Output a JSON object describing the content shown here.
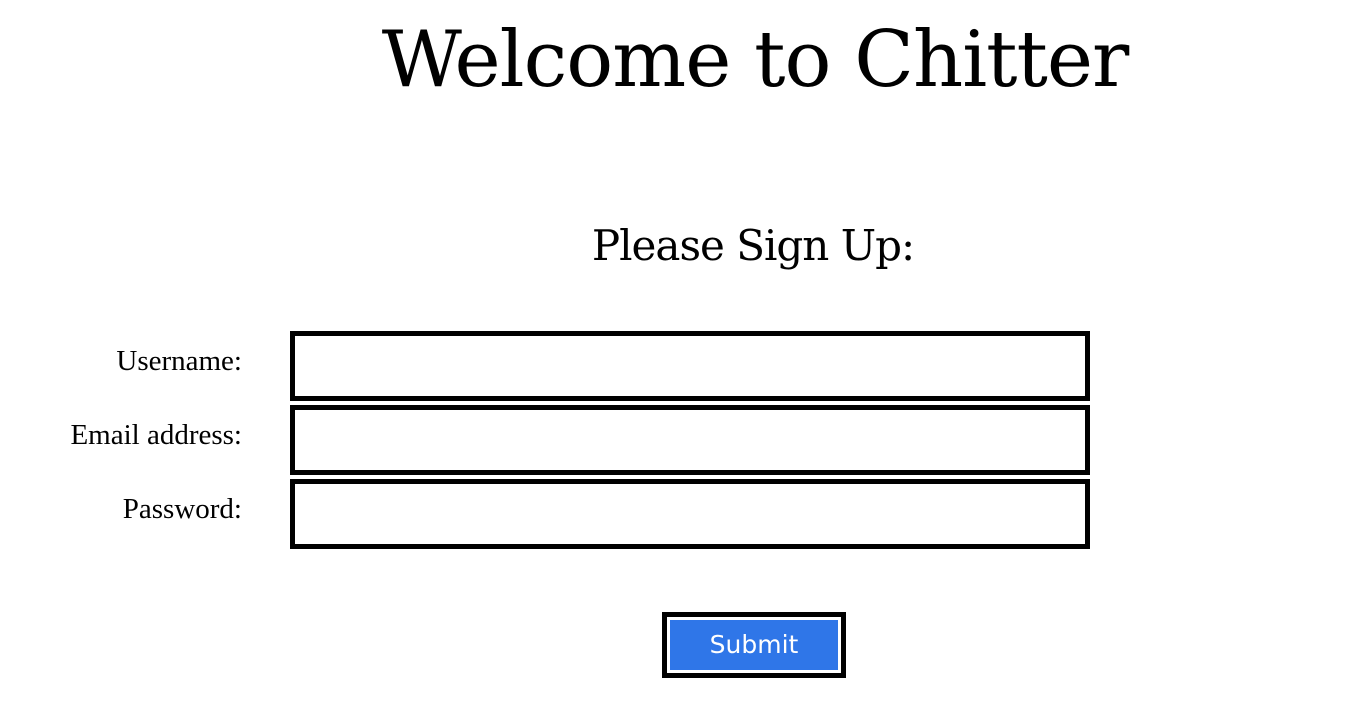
{
  "header": {
    "title": "Welcome to Chitter"
  },
  "signup": {
    "heading": "Please Sign Up:",
    "fields": [
      {
        "label": "Username:",
        "value": "",
        "placeholder": ""
      },
      {
        "label": "Email address:",
        "value": "",
        "placeholder": ""
      },
      {
        "label": "Password:",
        "value": "",
        "placeholder": ""
      }
    ],
    "submit_label": "Submit"
  },
  "colors": {
    "background": "#ffffff",
    "text": "#000000",
    "submit_button": "#2f76e8",
    "input_border": "#000000"
  }
}
